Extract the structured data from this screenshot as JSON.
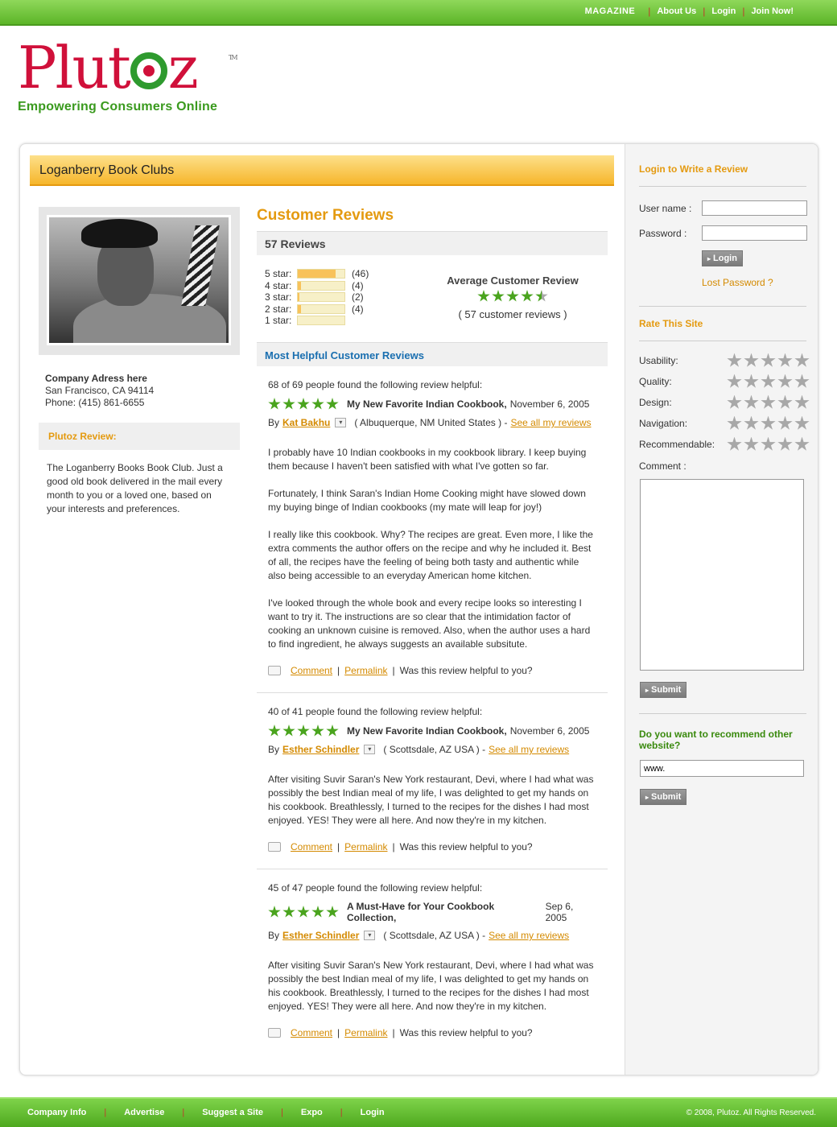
{
  "topnav": {
    "magazine": "MAGAZINE",
    "about": "About Us",
    "login": "Login",
    "join": "Join Now!"
  },
  "logo": {
    "brand_start": "Plut",
    "brand_end": "z",
    "tm": "TM",
    "tagline": "Empowering Consumers Online"
  },
  "page": {
    "title": "Loganberry Book Clubs"
  },
  "company": {
    "name": "Company Adress here",
    "city": "San Francisco, CA 94114",
    "phone": "Phone: (415) 861-6655"
  },
  "plutoz_review": {
    "heading": "Plutoz Review:",
    "text": "The Loganberry Books Book Club. Just a good old book delivered in the mail every month to you or a loved one, based on your interests and preferences."
  },
  "customer_reviews": {
    "title": "Customer Reviews",
    "count_label": "57 Reviews",
    "breakdown": [
      {
        "label": "5 star:",
        "count": "(46)",
        "fraction": 0.807
      },
      {
        "label": "4 star:",
        "count": "(4)",
        "fraction": 0.07
      },
      {
        "label": "3 star:",
        "count": "(2)",
        "fraction": 0.035
      },
      {
        "label": "2 star:",
        "count": "(4)",
        "fraction": 0.07
      },
      {
        "label": "1 star:",
        "count": "",
        "fraction": 0.0
      }
    ],
    "average_heading": "Average Customer Review",
    "average_rating": 4.5,
    "average_sub": "( 57 customer reviews )",
    "helpful_heading": "Most Helpful Customer Reviews"
  },
  "reviews": [
    {
      "helpful": "68 of 69 people found the following review helpful:",
      "stars": 5,
      "title": "My New Favorite Indian Cookbook,",
      "date": "November 6, 2005",
      "by": "By",
      "author": "Kat Bakhu",
      "location": "( Albuquerque, NM United States ) -",
      "see_all": "See all my reviews",
      "paragraphs": [
        "I probably have 10 Indian cookbooks in my cookbook library. I keep buying them because I haven't been satisfied with what I've gotten so far.",
        "Fortunately, I think Saran's Indian Home Cooking might have slowed down my buying binge of Indian cookbooks (my mate will leap for joy!)",
        "I really like this cookbook. Why? The recipes are great. Even more, I like the extra comments the author offers on the recipe and why he included it. Best of all, the recipes have the feeling of being both tasty and authentic while also being accessible to an everyday American home kitchen.",
        "I've looked through the whole book and every recipe looks so interesting I want to try it. The instructions are so clear that the intimidation factor of cooking an unknown cuisine is removed. Also, when the author uses a hard to find ingredient, he always suggests an available subsitute."
      ],
      "comment": "Comment",
      "permalink": "Permalink",
      "question": "Was this review helpful to you?"
    },
    {
      "helpful": "40 of 41 people found the following review helpful:",
      "stars": 5,
      "title": "My New Favorite Indian Cookbook,",
      "date": "November 6, 2005",
      "by": "By",
      "author": "Esther Schindler",
      "location": "( Scottsdale, AZ USA ) -",
      "see_all": "See all my reviews",
      "paragraphs": [
        "After visiting Suvir Saran's New York restaurant, Devi, where I had what was possibly the best Indian meal of my life, I was delighted to get my hands on his cookbook. Breathlessly, I turned to the recipes for the dishes I had most enjoyed. YES! They were all here. And now they're in my kitchen."
      ],
      "comment": "Comment",
      "permalink": "Permalink",
      "question": "Was this review helpful to you?"
    },
    {
      "helpful": "45 of 47 people found the following review helpful:",
      "stars": 5,
      "title": "A Must-Have for Your Cookbook Collection,",
      "date": "Sep 6, 2005",
      "by": "By",
      "author": "Esther Schindler",
      "location": "( Scottsdale, AZ USA ) -",
      "see_all": "See all my reviews",
      "paragraphs": [
        "After visiting Suvir Saran's New York restaurant, Devi, where I had what was possibly the best Indian meal of my life, I was delighted to get my hands on his cookbook. Breathlessly, I turned to the recipes for the dishes I had most enjoyed. YES! They were all here. And now they're in my kitchen."
      ],
      "comment": "Comment",
      "permalink": "Permalink",
      "question": "Was this review helpful to you?"
    }
  ],
  "login_form": {
    "heading": "Login to Write a Review",
    "username_label": "User name :",
    "password_label": "Password :",
    "username_value": "",
    "password_value": "",
    "login_button": "Login",
    "lost_password": "Lost Password ?"
  },
  "rate_site": {
    "heading": "Rate This Site",
    "criteria": [
      {
        "label": "Usability:",
        "rating": 0
      },
      {
        "label": "Quality:",
        "rating": 0
      },
      {
        "label": "Design:",
        "rating": 0
      },
      {
        "label": "Navigation:",
        "rating": 0
      },
      {
        "label": "Recommendable:",
        "rating": 0
      }
    ],
    "comment_label": "Comment :",
    "comment_value": "",
    "submit": "Submit"
  },
  "recommend": {
    "heading": "Do you want to recommend other website?",
    "value": "www.",
    "submit": "Submit"
  },
  "footer": {
    "links": [
      "Company Info",
      "Advertise",
      "Suggest a Site",
      "Expo",
      "Login"
    ],
    "copyright": "© 2008, Plutoz. All Rights Reserved."
  },
  "colors": {
    "green": "#5cb528",
    "orange": "#e49a10",
    "brand_red": "#d0103a",
    "star_green": "#4aa41e"
  }
}
